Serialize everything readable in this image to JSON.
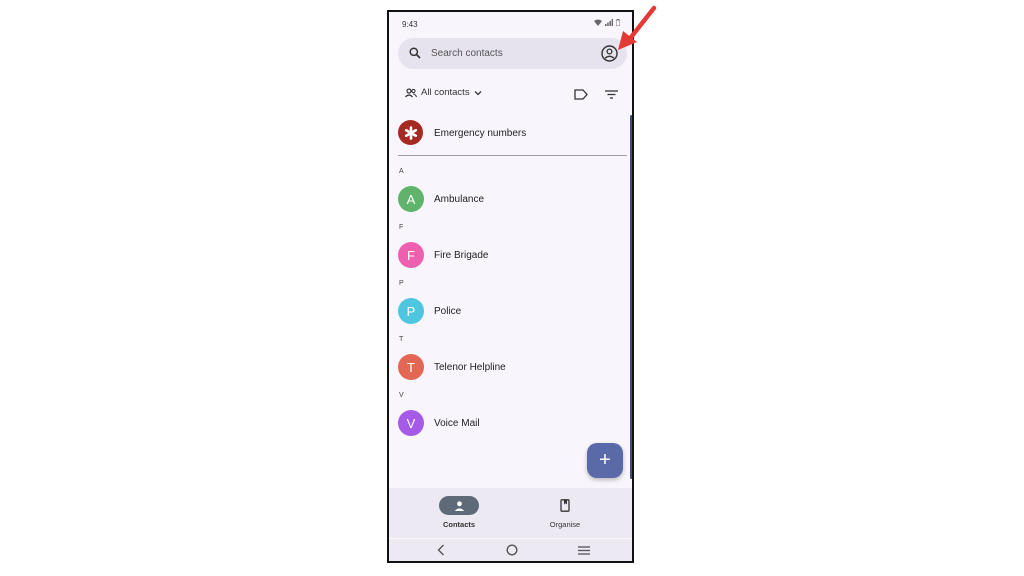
{
  "status_bar": {
    "time": "9:43"
  },
  "search": {
    "placeholder": "Search contacts"
  },
  "filter_bar": {
    "chip_label": "All contacts"
  },
  "emergency": {
    "label": "Emergency numbers",
    "color": "#a52a22"
  },
  "sections": [
    {
      "letter": "A",
      "name": "Ambulance",
      "initial": "A",
      "color": "#5fb36b"
    },
    {
      "letter": "F",
      "name": "Fire Brigade",
      "initial": "F",
      "color": "#ef5fb0"
    },
    {
      "letter": "P",
      "name": "Police",
      "initial": "P",
      "color": "#4fc6df"
    },
    {
      "letter": "T",
      "name": "Telenor Helpline",
      "initial": "T",
      "color": "#e36754"
    },
    {
      "letter": "V",
      "name": "Voice Mail",
      "initial": "V",
      "color": "#a65be8"
    }
  ],
  "fab": {
    "label": "+"
  },
  "bottom_nav": {
    "contacts_label": "Contacts",
    "organise_label": "Organise"
  },
  "icons": [
    "search-icon",
    "account-circle-icon",
    "people-icon",
    "chevron-down-icon",
    "label-icon",
    "filter-icon",
    "asterisk-icon",
    "person-icon",
    "bookmark-icon",
    "back-icon",
    "home-icon",
    "recents-icon",
    "arrow-icon"
  ],
  "colors": {
    "accent": "#5a6aa8",
    "annotation_arrow": "#e53935"
  }
}
